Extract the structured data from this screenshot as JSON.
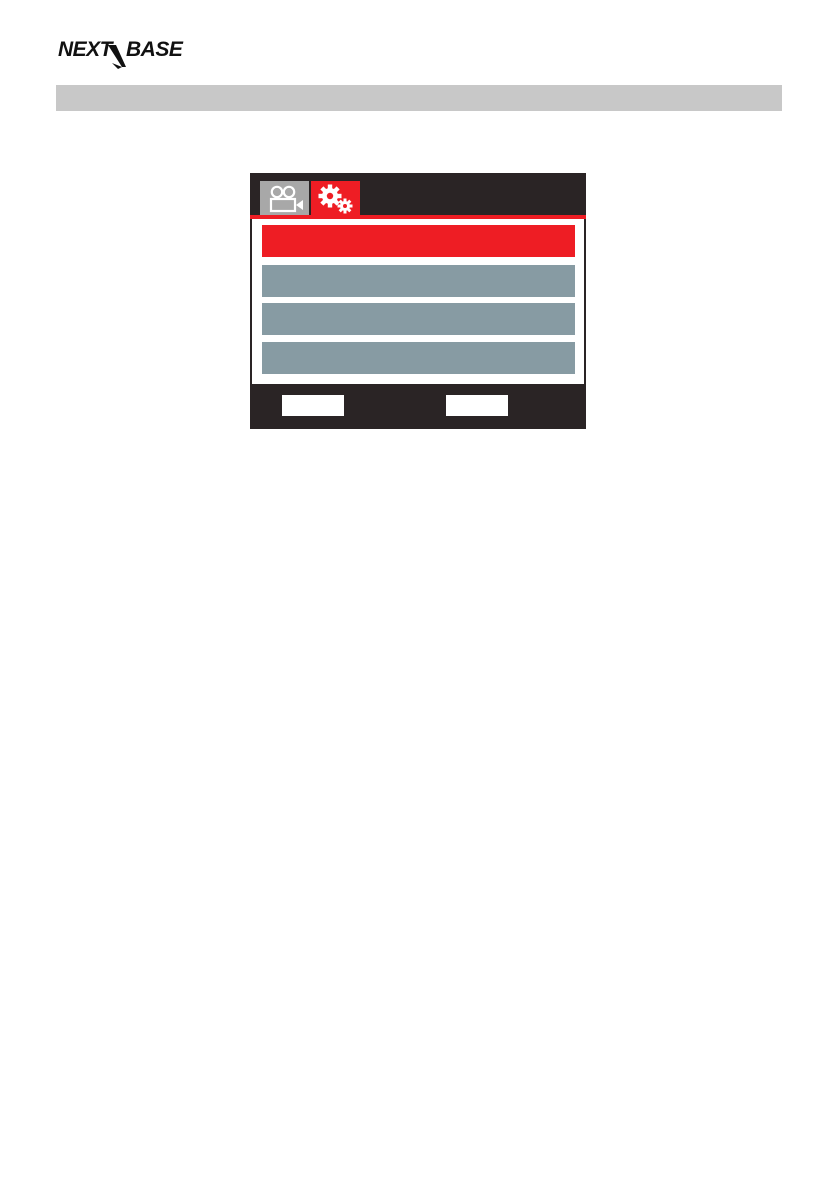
{
  "header": {
    "brand": "NEXTBASE",
    "section_title": ""
  },
  "colors": {
    "accent": "#ee1d24",
    "menu_item": "#879ba3",
    "screen_background": "#2a2425",
    "section_bar": "#c8c8c8",
    "inactive_tab": "#a8a8a8"
  },
  "device_screen": {
    "tabs": [
      {
        "icon": "video-camera-icon",
        "active": false
      },
      {
        "icon": "gears-icon",
        "active": true
      }
    ],
    "menu_items": [
      {
        "label": "",
        "selected": true
      },
      {
        "label": "",
        "selected": false
      },
      {
        "label": "",
        "selected": false
      },
      {
        "label": "",
        "selected": false
      }
    ],
    "softkeys": [
      {
        "label": ""
      },
      {
        "label": ""
      }
    ]
  }
}
